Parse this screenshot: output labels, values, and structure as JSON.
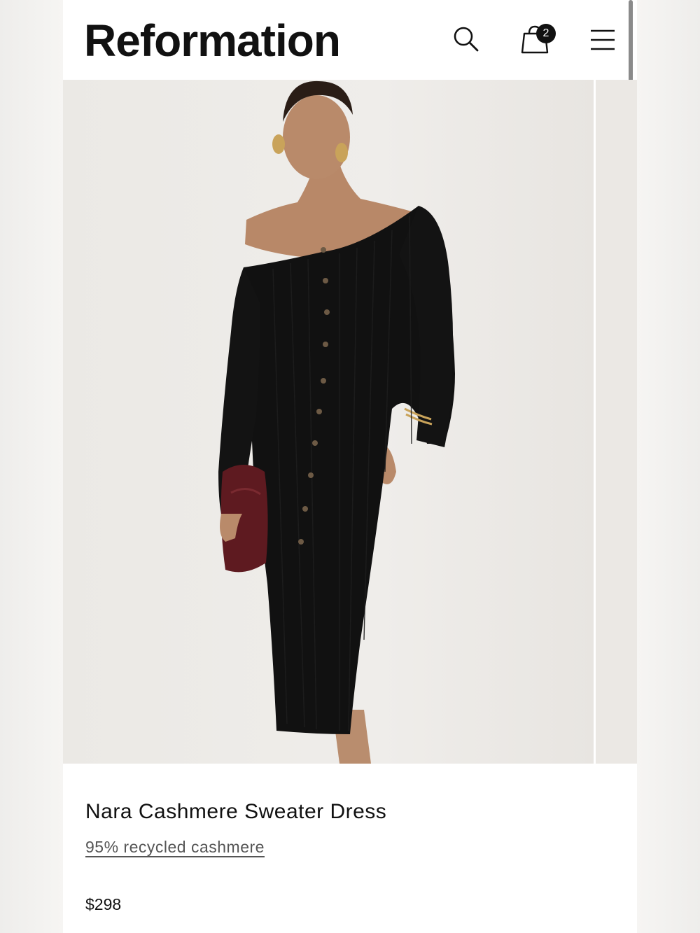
{
  "header": {
    "brand": "Reformation",
    "cart_count": "2",
    "icons": [
      "search-icon",
      "shopping-bag-icon",
      "menu-icon"
    ]
  },
  "product": {
    "name": "Nara Cashmere Sweater Dress",
    "material": "95% recycled cashmere",
    "price": "$298",
    "image_description_colors": {
      "dress": "#101010",
      "clutch": "#6b1c22",
      "background": "#ece9e5"
    }
  }
}
